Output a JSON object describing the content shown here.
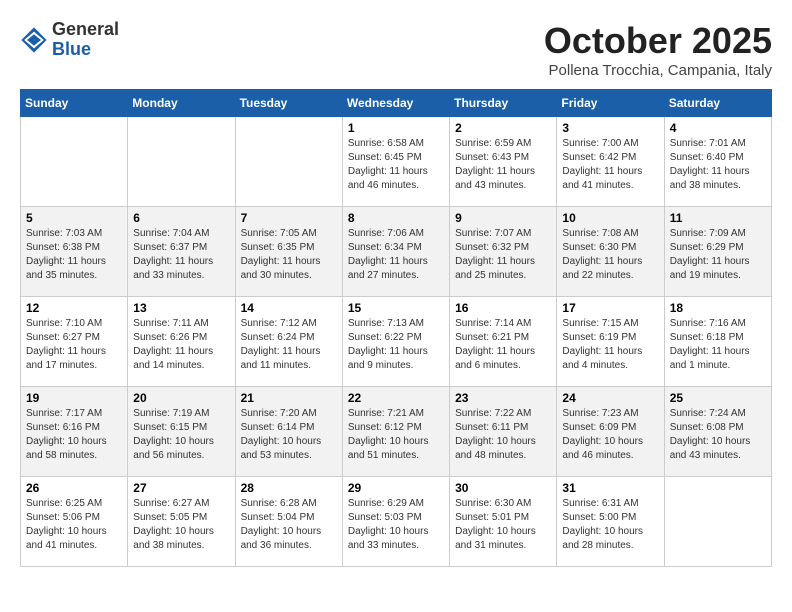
{
  "header": {
    "logo_general": "General",
    "logo_blue": "Blue",
    "month_title": "October 2025",
    "location": "Pollena Trocchia, Campania, Italy"
  },
  "days_of_week": [
    "Sunday",
    "Monday",
    "Tuesday",
    "Wednesday",
    "Thursday",
    "Friday",
    "Saturday"
  ],
  "weeks": [
    [
      {
        "day": "",
        "info": ""
      },
      {
        "day": "",
        "info": ""
      },
      {
        "day": "",
        "info": ""
      },
      {
        "day": "1",
        "info": "Sunrise: 6:58 AM\nSunset: 6:45 PM\nDaylight: 11 hours and 46 minutes."
      },
      {
        "day": "2",
        "info": "Sunrise: 6:59 AM\nSunset: 6:43 PM\nDaylight: 11 hours and 43 minutes."
      },
      {
        "day": "3",
        "info": "Sunrise: 7:00 AM\nSunset: 6:42 PM\nDaylight: 11 hours and 41 minutes."
      },
      {
        "day": "4",
        "info": "Sunrise: 7:01 AM\nSunset: 6:40 PM\nDaylight: 11 hours and 38 minutes."
      }
    ],
    [
      {
        "day": "5",
        "info": "Sunrise: 7:03 AM\nSunset: 6:38 PM\nDaylight: 11 hours and 35 minutes."
      },
      {
        "day": "6",
        "info": "Sunrise: 7:04 AM\nSunset: 6:37 PM\nDaylight: 11 hours and 33 minutes."
      },
      {
        "day": "7",
        "info": "Sunrise: 7:05 AM\nSunset: 6:35 PM\nDaylight: 11 hours and 30 minutes."
      },
      {
        "day": "8",
        "info": "Sunrise: 7:06 AM\nSunset: 6:34 PM\nDaylight: 11 hours and 27 minutes."
      },
      {
        "day": "9",
        "info": "Sunrise: 7:07 AM\nSunset: 6:32 PM\nDaylight: 11 hours and 25 minutes."
      },
      {
        "day": "10",
        "info": "Sunrise: 7:08 AM\nSunset: 6:30 PM\nDaylight: 11 hours and 22 minutes."
      },
      {
        "day": "11",
        "info": "Sunrise: 7:09 AM\nSunset: 6:29 PM\nDaylight: 11 hours and 19 minutes."
      }
    ],
    [
      {
        "day": "12",
        "info": "Sunrise: 7:10 AM\nSunset: 6:27 PM\nDaylight: 11 hours and 17 minutes."
      },
      {
        "day": "13",
        "info": "Sunrise: 7:11 AM\nSunset: 6:26 PM\nDaylight: 11 hours and 14 minutes."
      },
      {
        "day": "14",
        "info": "Sunrise: 7:12 AM\nSunset: 6:24 PM\nDaylight: 11 hours and 11 minutes."
      },
      {
        "day": "15",
        "info": "Sunrise: 7:13 AM\nSunset: 6:22 PM\nDaylight: 11 hours and 9 minutes."
      },
      {
        "day": "16",
        "info": "Sunrise: 7:14 AM\nSunset: 6:21 PM\nDaylight: 11 hours and 6 minutes."
      },
      {
        "day": "17",
        "info": "Sunrise: 7:15 AM\nSunset: 6:19 PM\nDaylight: 11 hours and 4 minutes."
      },
      {
        "day": "18",
        "info": "Sunrise: 7:16 AM\nSunset: 6:18 PM\nDaylight: 11 hours and 1 minute."
      }
    ],
    [
      {
        "day": "19",
        "info": "Sunrise: 7:17 AM\nSunset: 6:16 PM\nDaylight: 10 hours and 58 minutes."
      },
      {
        "day": "20",
        "info": "Sunrise: 7:19 AM\nSunset: 6:15 PM\nDaylight: 10 hours and 56 minutes."
      },
      {
        "day": "21",
        "info": "Sunrise: 7:20 AM\nSunset: 6:14 PM\nDaylight: 10 hours and 53 minutes."
      },
      {
        "day": "22",
        "info": "Sunrise: 7:21 AM\nSunset: 6:12 PM\nDaylight: 10 hours and 51 minutes."
      },
      {
        "day": "23",
        "info": "Sunrise: 7:22 AM\nSunset: 6:11 PM\nDaylight: 10 hours and 48 minutes."
      },
      {
        "day": "24",
        "info": "Sunrise: 7:23 AM\nSunset: 6:09 PM\nDaylight: 10 hours and 46 minutes."
      },
      {
        "day": "25",
        "info": "Sunrise: 7:24 AM\nSunset: 6:08 PM\nDaylight: 10 hours and 43 minutes."
      }
    ],
    [
      {
        "day": "26",
        "info": "Sunrise: 6:25 AM\nSunset: 5:06 PM\nDaylight: 10 hours and 41 minutes."
      },
      {
        "day": "27",
        "info": "Sunrise: 6:27 AM\nSunset: 5:05 PM\nDaylight: 10 hours and 38 minutes."
      },
      {
        "day": "28",
        "info": "Sunrise: 6:28 AM\nSunset: 5:04 PM\nDaylight: 10 hours and 36 minutes."
      },
      {
        "day": "29",
        "info": "Sunrise: 6:29 AM\nSunset: 5:03 PM\nDaylight: 10 hours and 33 minutes."
      },
      {
        "day": "30",
        "info": "Sunrise: 6:30 AM\nSunset: 5:01 PM\nDaylight: 10 hours and 31 minutes."
      },
      {
        "day": "31",
        "info": "Sunrise: 6:31 AM\nSunset: 5:00 PM\nDaylight: 10 hours and 28 minutes."
      },
      {
        "day": "",
        "info": ""
      }
    ]
  ]
}
